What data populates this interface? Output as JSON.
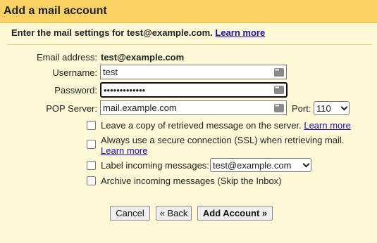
{
  "dialog": {
    "title": "Add a mail account",
    "intro": "Enter the mail settings for test@example.com.",
    "learn_more": "Learn more"
  },
  "form": {
    "email_label": "Email address:",
    "email_value": "test@example.com",
    "username_label": "Username:",
    "username_value": "test",
    "password_label": "Password:",
    "password_value": "•••••••••••••",
    "pop_label": "POP Server:",
    "pop_value": "mail.example.com",
    "port_label": "Port:",
    "port_value": "110"
  },
  "options": {
    "leave_copy": "Leave a copy of retrieved message on the server.",
    "leave_copy_link": "Learn more",
    "ssl_line1": "Always use a secure connection (SSL) when retrieving mail.",
    "ssl_link": "Learn more",
    "label_incoming": "Label incoming messages:",
    "label_value": "test@example.com",
    "archive": "Archive incoming messages (Skip the Inbox)"
  },
  "buttons": {
    "cancel": "Cancel",
    "back": "« Back",
    "add": "Add Account »"
  },
  "colors": {
    "titlebar": "#fad163",
    "background": "#fff9d7",
    "link": "#1a0dab"
  }
}
